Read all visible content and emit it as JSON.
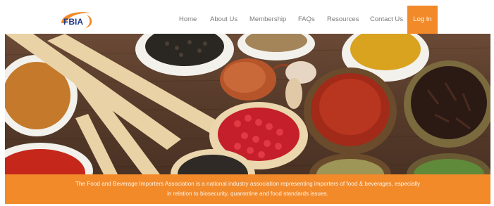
{
  "site": {
    "logo_text": "FBIA",
    "logo_color": "#1f3a8a",
    "accent_color": "#f28a2a"
  },
  "nav": {
    "items": [
      {
        "label": "Home"
      },
      {
        "label": "About Us"
      },
      {
        "label": "Membership"
      },
      {
        "label": "FAQs"
      },
      {
        "label": "Resources"
      },
      {
        "label": "Contact Us"
      }
    ],
    "login_label": "Log In"
  },
  "hero": {
    "image_subject": "spices-in-wooden-spoons-and-bowls"
  },
  "banner": {
    "line1": "The Food and Beverage Importers Association is a national industry association representing importers of food & beverages, especially",
    "line2": "in relation to biosecurity, quarantine and food standards issues."
  }
}
